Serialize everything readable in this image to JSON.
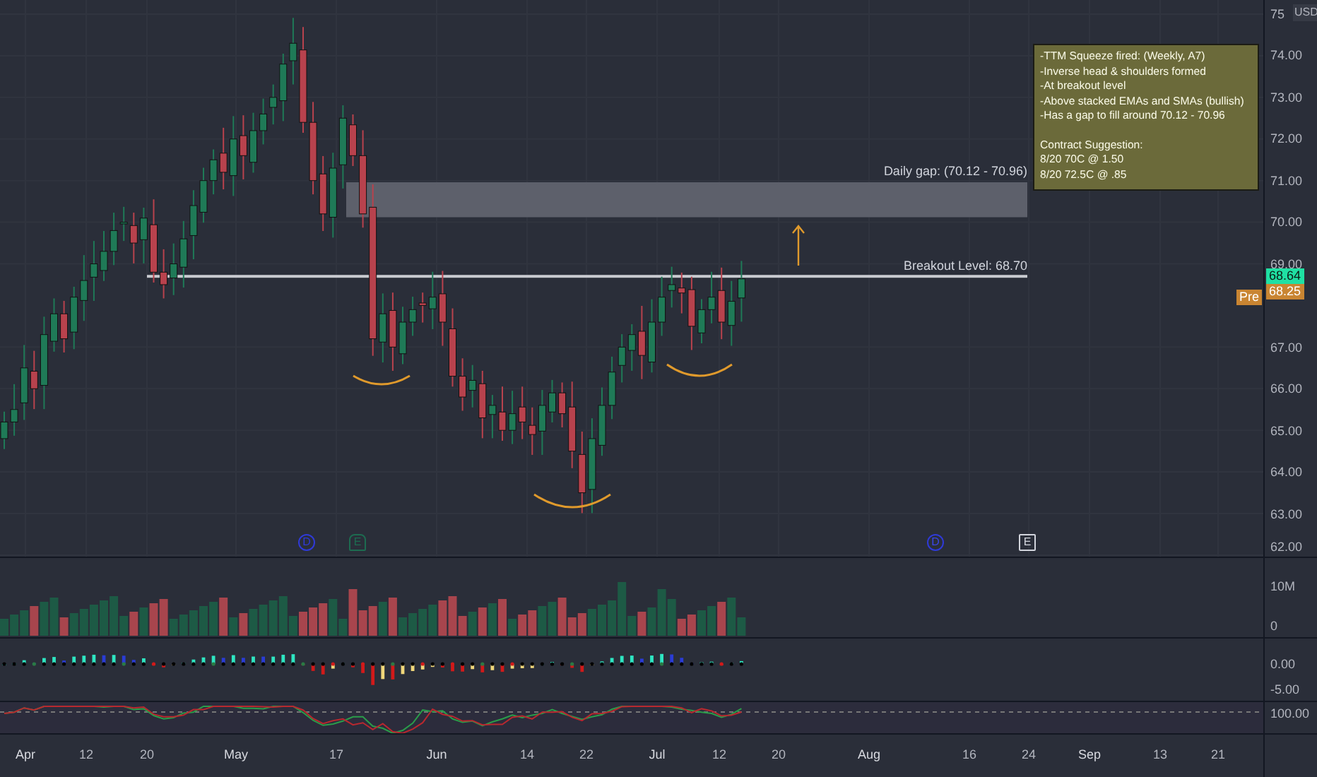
{
  "price_axis": {
    "currency": "USD",
    "ticks": [
      "75",
      "74.00",
      "73.00",
      "72.00",
      "71.00",
      "70.00",
      "69.00",
      "67.00",
      "66.00",
      "65.00",
      "64.00",
      "63.00",
      "62.00"
    ]
  },
  "last_price": {
    "value": "68.64"
  },
  "premarket": {
    "label": "Pre",
    "value": "68.25"
  },
  "annotations": [
    {
      "kind": "gap",
      "label": "Daily gap: (70.12 - 70.96)"
    },
    {
      "kind": "level",
      "label": "Breakout Level: 68.70"
    }
  ],
  "note": {
    "bullets": [
      "-TTM Squeeze fired: (Weekly, A7)",
      "-Inverse head & shoulders formed",
      "-At breakout level",
      "-Above stacked EMAs and SMAs (bullish)",
      "-Has a gap to fill around 70.12 - 70.96"
    ],
    "heading": "Contract Suggestion:",
    "contracts": [
      "8/20 70C @ 1.50",
      "8/20 72.5C @ .85"
    ]
  },
  "events": [
    {
      "kind": "dividend",
      "label": "D",
      "upcoming": false
    },
    {
      "kind": "earnings",
      "label": "E",
      "upcoming": false
    },
    {
      "kind": "dividend",
      "label": "D",
      "upcoming": true
    },
    {
      "kind": "earnings",
      "label": "E",
      "upcoming": true
    }
  ],
  "volume_pane": {
    "ticks": [
      "10M",
      "0"
    ]
  },
  "squeeze_pane": {
    "ticks": [
      "0.00",
      "-5.00"
    ]
  },
  "oscillator_pane": {
    "ticks": [
      "100.00"
    ]
  },
  "date_axis": {
    "ticks": [
      {
        "label": "Apr",
        "kind": "month"
      },
      {
        "label": "12",
        "kind": "day"
      },
      {
        "label": "20",
        "kind": "day"
      },
      {
        "label": "May",
        "kind": "month"
      },
      {
        "label": "17",
        "kind": "day"
      },
      {
        "label": "Jun",
        "kind": "month"
      },
      {
        "label": "14",
        "kind": "day"
      },
      {
        "label": "22",
        "kind": "day"
      },
      {
        "label": "Jul",
        "kind": "month"
      },
      {
        "label": "12",
        "kind": "day"
      },
      {
        "label": "20",
        "kind": "day"
      },
      {
        "label": "Aug",
        "kind": "month"
      },
      {
        "label": "16",
        "kind": "day"
      },
      {
        "label": "24",
        "kind": "day"
      },
      {
        "label": "Sep",
        "kind": "month"
      },
      {
        "label": "13",
        "kind": "day"
      },
      {
        "label": "21",
        "kind": "day"
      }
    ]
  }
}
